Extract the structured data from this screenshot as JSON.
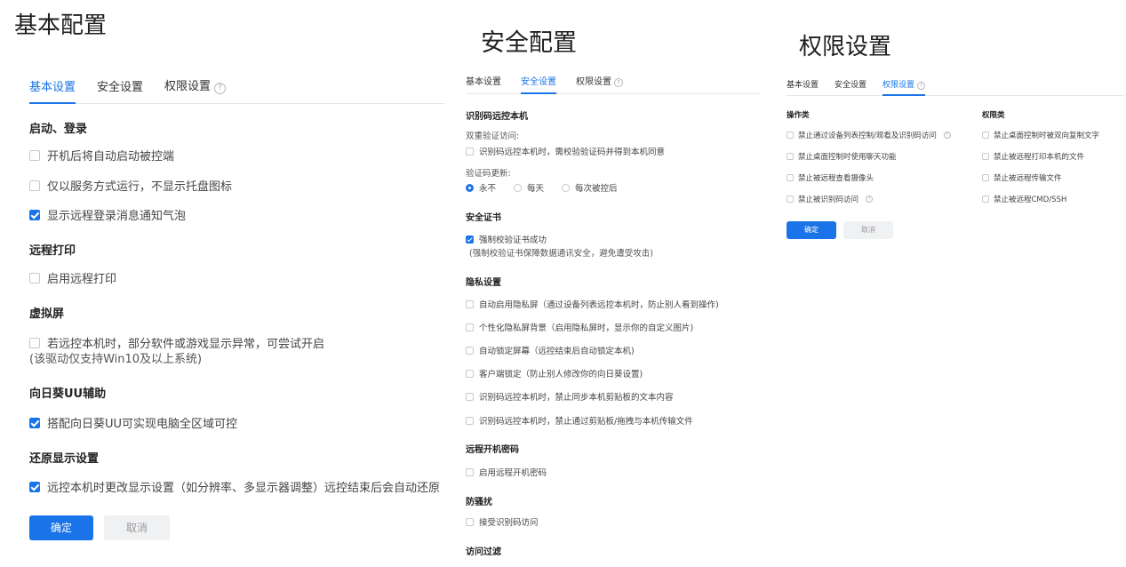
{
  "panel1": {
    "heading": "基本配置",
    "tabs": [
      {
        "label": "基本设置"
      },
      {
        "label": "安全设置"
      },
      {
        "label": "权限设置"
      }
    ],
    "sections": {
      "startup": {
        "title": "启动、登录",
        "items": [
          "开机后将自动启动被控端",
          "仅以服务方式运行，不显示托盘图标",
          "显示远程登录消息通知气泡"
        ]
      },
      "print": {
        "title": "远程打印",
        "items": [
          "启用远程打印"
        ]
      },
      "virtual": {
        "title": "虚拟屏",
        "item": "若远控本机时，部分软件或游戏显示异常，可尝试开启",
        "note": "(该驱动仅支持Win10及以上系统)"
      },
      "uu": {
        "title": "向日葵UU辅助",
        "item": "搭配向日葵UU可实现电脑全区域可控"
      },
      "restore": {
        "title": "还原显示设置",
        "item": "远控本机时更改显示设置（如分辨率、多显示器调整）远控结束后会自动还原"
      }
    },
    "buttons": {
      "confirm": "确定",
      "cancel": "取消"
    }
  },
  "panel2": {
    "heading": "安全配置",
    "tabs": [
      {
        "label": "基本设置"
      },
      {
        "label": "安全设置"
      },
      {
        "label": "权限设置"
      }
    ],
    "sections": {
      "identify": {
        "title": "识别码远控本机",
        "double_label": "双重验证访问:",
        "double_item": "识别码远控本机时，需校验验证码并得到本机同意",
        "update_label": "验证码更新:",
        "radio_options": [
          "永不",
          "每天",
          "每次被控后"
        ]
      },
      "cert": {
        "title": "安全证书",
        "item": "强制校验证书成功",
        "note": "(强制校验证书保障数据通讯安全，避免遭受攻击)"
      },
      "privacy": {
        "title": "隐私设置",
        "items": [
          "自动启用隐私屏（通过设备列表远控本机时，防止别人看到操作)",
          "个性化隐私屏背景（启用隐私屏时，显示你的自定义图片)",
          "自动锁定屏幕（远控结束后自动锁定本机)",
          "客户端锁定（防止别人修改你的向日葵设置)",
          "识别码远控本机时，禁止同步本机剪贴板的文本内容",
          "识别码远控本机时，禁止通过剪贴板/拖拽与本机传输文件"
        ]
      },
      "remote_pwd": {
        "title": "远程开机密码",
        "item": "启用远程开机密码"
      },
      "anti": {
        "title": "防骚扰",
        "item": "接受识别码访问"
      },
      "filter": {
        "title": "访问过滤"
      }
    }
  },
  "panel3": {
    "heading": "权限设置",
    "tabs": [
      {
        "label": "基本设置"
      },
      {
        "label": "安全设置"
      },
      {
        "label": "权限设置"
      }
    ],
    "ops": {
      "title": "操作类",
      "items": [
        "禁止通过设备列表控制/观看及识别码访问",
        "禁止桌面控制时使用聊天功能",
        "禁止被远程查看摄像头",
        "禁止被识别码访问"
      ]
    },
    "perms": {
      "title": "权限类",
      "items": [
        "禁止桌面控制时被双向复制文字",
        "禁止被远程打印本机的文件",
        "禁止被远程传输文件",
        "禁止被远程CMD/SSH"
      ]
    },
    "buttons": {
      "confirm": "确定",
      "cancel": "取消"
    }
  }
}
